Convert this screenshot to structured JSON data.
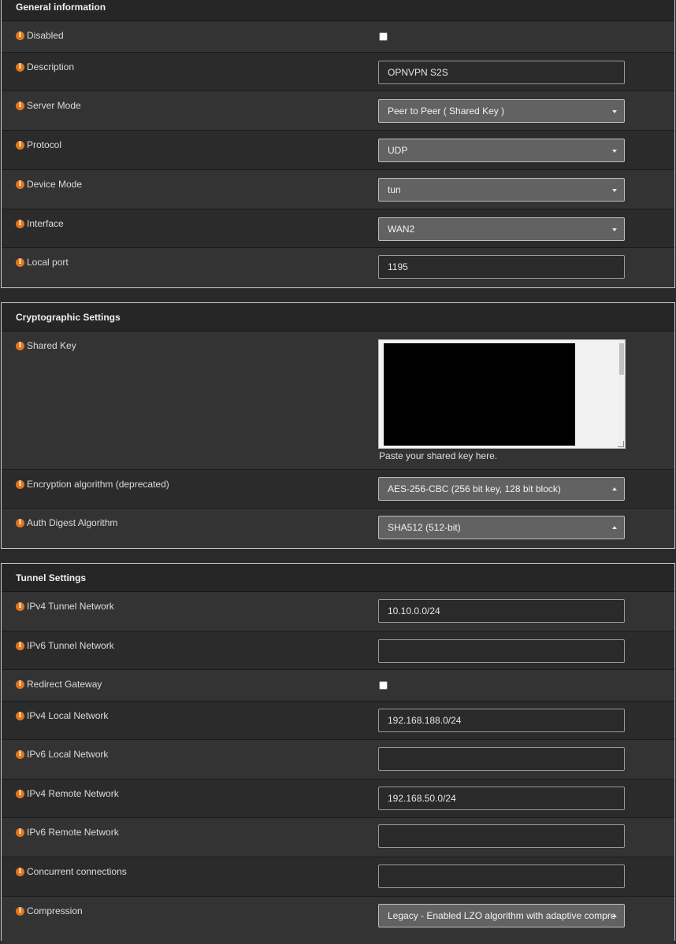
{
  "general": {
    "title": "General information",
    "disabled_label": "Disabled",
    "description_label": "Description",
    "description_value": "OPNVPN S2S",
    "server_mode_label": "Server Mode",
    "server_mode_value": "Peer to Peer ( Shared Key )",
    "protocol_label": "Protocol",
    "protocol_value": "UDP",
    "device_mode_label": "Device Mode",
    "device_mode_value": "tun",
    "interface_label": "Interface",
    "interface_value": "WAN2",
    "local_port_label": "Local port",
    "local_port_value": "1195"
  },
  "crypto": {
    "title": "Cryptographic Settings",
    "shared_key_label": "Shared Key",
    "shared_key_help": "Paste your shared key here.",
    "encryption_label": "Encryption algorithm (deprecated)",
    "encryption_value": "AES-256-CBC (256 bit key, 128 bit block)",
    "auth_label": "Auth Digest Algorithm",
    "auth_value": "SHA512 (512-bit)"
  },
  "tunnel": {
    "title": "Tunnel Settings",
    "ipv4_tunnel_label": "IPv4 Tunnel Network",
    "ipv4_tunnel_value": "10.10.0.0/24",
    "ipv6_tunnel_label": "IPv6 Tunnel Network",
    "ipv6_tunnel_value": "",
    "redirect_label": "Redirect Gateway",
    "ipv4_local_label": "IPv4 Local Network",
    "ipv4_local_value": "192.168.188.0/24",
    "ipv6_local_label": "IPv6 Local Network",
    "ipv6_local_value": "",
    "ipv4_remote_label": "IPv4 Remote Network",
    "ipv4_remote_value": "192.168.50.0/24",
    "ipv6_remote_label": "IPv6 Remote Network",
    "ipv6_remote_value": "",
    "concurrent_label": "Concurrent connections",
    "concurrent_value": "",
    "compression_label": "Compression",
    "compression_value": "Legacy - Enabled LZO algorithm with adaptive comprе"
  },
  "icons": {
    "info": "info-icon",
    "caret": "caret-icon"
  },
  "colors": {
    "accent": "#e2761b",
    "background": "#2a2a2a"
  }
}
